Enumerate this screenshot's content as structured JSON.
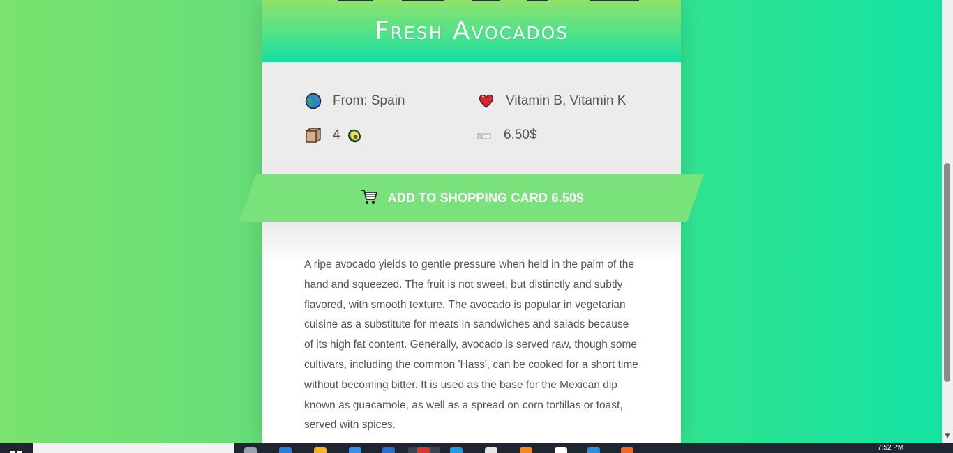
{
  "product": {
    "title": "Fresh Avocados",
    "origin": "From: Spain",
    "vitamins": "Vitamin B, Vitamin K",
    "quantity": "4",
    "price": "6.50$",
    "add_button_label": "ADD TO SHOPPING CARD 6.50$",
    "description": "A ripe avocado yields to gentle pressure when held in the palm of the hand and squeezed. The fruit is not sweet, but distinctly and subtly flavored, with smooth texture. The avocado is popular in vegetarian cuisine as a substitute for meats in sandwiches and salads because of its high fat content. Generally, avocado is served raw, though some cultivars, including the common 'Hass', can be cooked for a short time without becoming bitter. It is used as the base for the Mexican dip known as guacamole, as well as a spread on corn tortillas or toast, served with spices."
  },
  "icons": {
    "origin": "globe-icon",
    "vitamins": "heart-icon",
    "quantity": "box-icon",
    "quantity_unit": "avocado-icon",
    "price": "banknote-icon",
    "button": "shopping-cart-icon"
  },
  "colors": {
    "accent_green": "#7ae27a",
    "title_gradient_top": "#8ee26a",
    "title_gradient_bottom": "#13e0a2",
    "text_gray": "#555555"
  },
  "taskbar": {
    "clock": "7:52 PM"
  }
}
